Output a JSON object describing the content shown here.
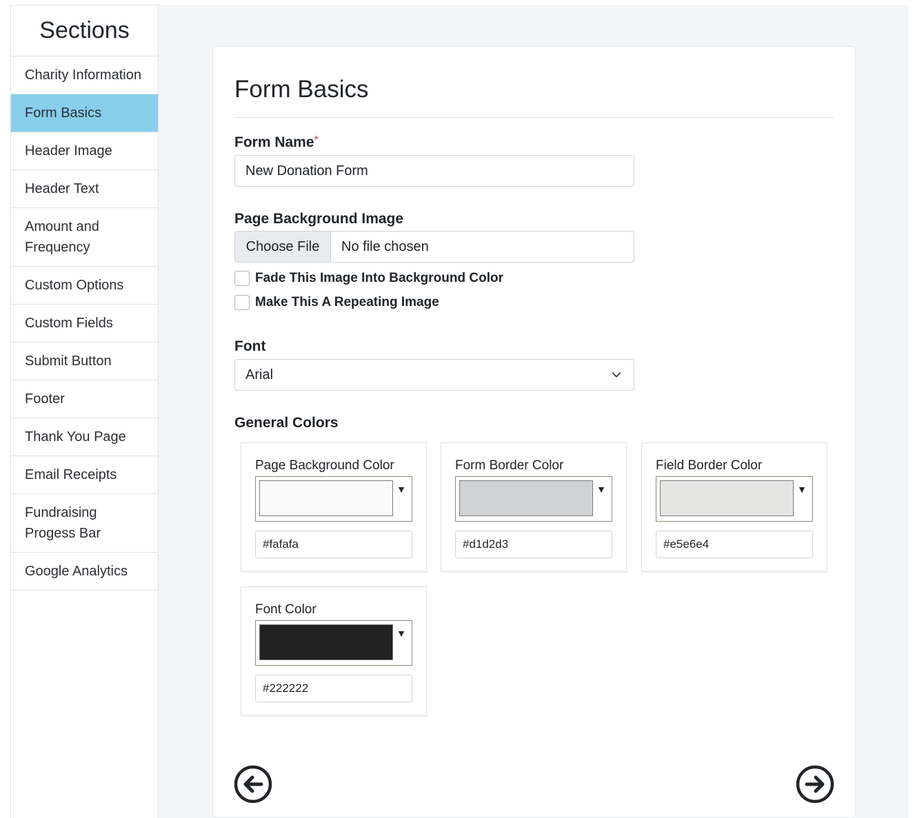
{
  "sidebar": {
    "title": "Sections",
    "items": [
      {
        "label": "Charity Information"
      },
      {
        "label": "Form Basics"
      },
      {
        "label": "Header Image"
      },
      {
        "label": "Header Text"
      },
      {
        "label": "Amount and Frequency"
      },
      {
        "label": "Custom Options"
      },
      {
        "label": "Custom Fields"
      },
      {
        "label": "Submit Button"
      },
      {
        "label": "Footer"
      },
      {
        "label": "Thank You Page"
      },
      {
        "label": "Email Receipts"
      },
      {
        "label": "Fundraising Progess Bar"
      },
      {
        "label": "Google Analytics"
      }
    ],
    "active_index": 1,
    "active_color": "#87ceeb"
  },
  "main": {
    "title": "Form Basics",
    "form_name": {
      "label": "Form Name",
      "required_mark": "*",
      "value": "New Donation Form"
    },
    "background_image": {
      "label": "Page Background Image",
      "button_label": "Choose File",
      "status": "No file chosen"
    },
    "checkboxes": [
      {
        "label": "Fade This Image Into Background Color",
        "checked": false
      },
      {
        "label": "Make This A Repeating Image",
        "checked": false
      }
    ],
    "font": {
      "label": "Font",
      "selected": "Arial"
    },
    "general_colors": {
      "label": "General Colors",
      "items": [
        {
          "label": "Page Background Color",
          "value": "#fafafa"
        },
        {
          "label": "Form Border Color",
          "value": "#d1d2d3"
        },
        {
          "label": "Field Border Color",
          "value": "#e5e6e4"
        },
        {
          "label": "Font Color",
          "value": "#222222"
        }
      ]
    },
    "nav": {
      "prev_icon": "arrow-left-circle-icon",
      "next_icon": "arrow-right-circle-icon"
    }
  }
}
